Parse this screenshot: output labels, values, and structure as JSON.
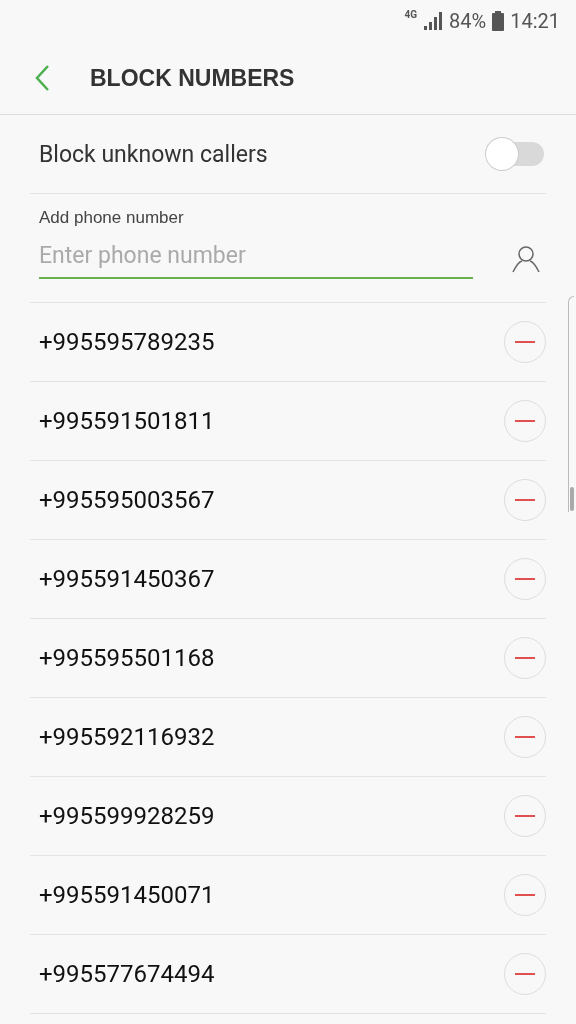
{
  "status_bar": {
    "network": "4G",
    "battery": "84%",
    "time": "14:21"
  },
  "header": {
    "title": "BLOCK NUMBERS"
  },
  "block_unknown": {
    "label": "Block unknown callers",
    "on": false
  },
  "add_number": {
    "label": "Add phone number",
    "placeholder": "Enter phone number"
  },
  "numbers": [
    {
      "number": "+995595789235"
    },
    {
      "number": "+995591501811"
    },
    {
      "number": "+995595003567"
    },
    {
      "number": "+995591450367"
    },
    {
      "number": "+995595501168"
    },
    {
      "number": "+995592116932"
    },
    {
      "number": "+995599928259"
    },
    {
      "number": "+995591450071"
    },
    {
      "number": "+995577674494"
    }
  ]
}
